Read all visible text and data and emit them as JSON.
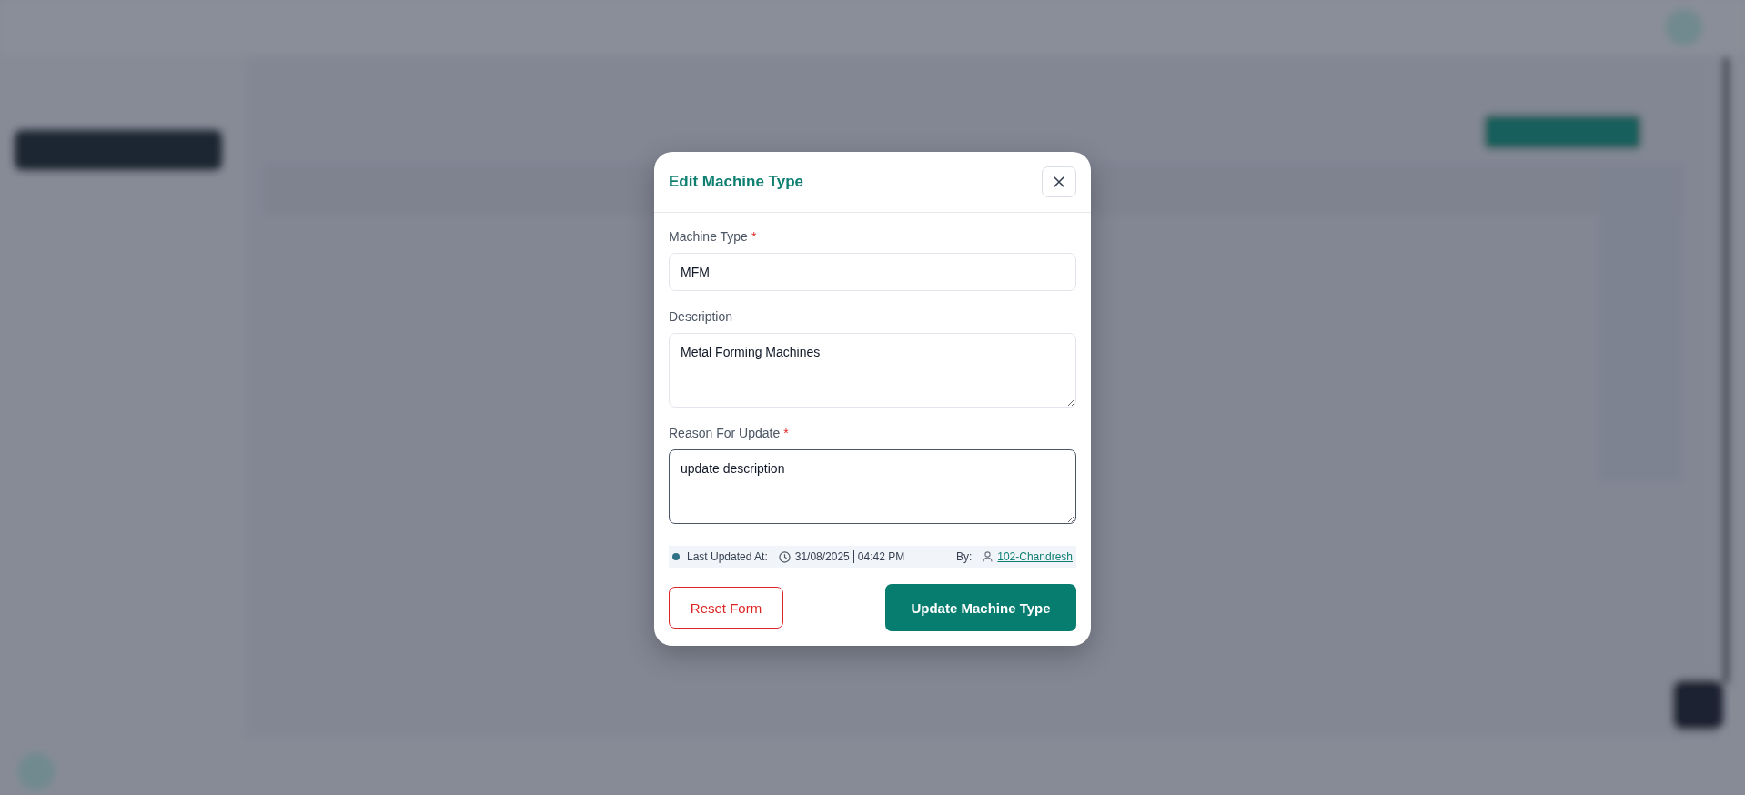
{
  "dialog": {
    "title": "Edit Machine Type",
    "fields": [
      {
        "kind": "input",
        "label": "Machine Type",
        "required_mark": "*",
        "value": "MFM",
        "focused": false
      },
      {
        "kind": "textarea",
        "label": "Description",
        "value": "Metal Forming Machines",
        "focused": false
      },
      {
        "kind": "textarea",
        "label": "Reason For Update",
        "required_mark": "*",
        "value": "update description",
        "focused": true
      }
    ],
    "last_updated": {
      "label": "Last Updated At:",
      "date": "31/08/2025",
      "time": "04:42 PM",
      "by_label": "By:",
      "user": "102-Chandresh"
    },
    "buttons": [
      {
        "kind": "secondary",
        "label": "Reset Form"
      },
      {
        "kind": "primary",
        "label": "Update Machine Type"
      }
    ]
  }
}
